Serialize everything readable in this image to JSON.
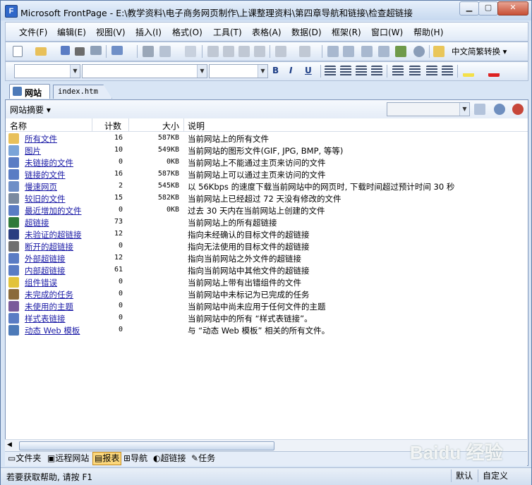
{
  "window": {
    "title": "Microsoft FrontPage - E:\\教学资料\\电子商务网页制作\\上课整理资料\\第四章导航和链接\\检查超链接"
  },
  "menu": [
    "文件(F)",
    "编辑(E)",
    "视图(V)",
    "插入(I)",
    "格式(O)",
    "工具(T)",
    "表格(A)",
    "数据(D)",
    "框架(R)",
    "窗口(W)",
    "帮助(H)"
  ],
  "toolbar": {
    "convert_label": "中文简繁转换 ▾"
  },
  "format_toolbar": {
    "bold": "B",
    "italic": "I",
    "underline": "U"
  },
  "tabs": {
    "site": "网站",
    "file": "index.htm"
  },
  "report": {
    "selector": "网站摘要 ▾"
  },
  "columns": {
    "name": "名称",
    "count": "计数",
    "size": "大小",
    "desc": "说明"
  },
  "rows": [
    {
      "name": "所有文件",
      "count": "16",
      "size": "587KB",
      "desc": "当前网站上的所有文件",
      "icon": "all-files-icon"
    },
    {
      "name": "图片",
      "count": "10",
      "size": "549KB",
      "desc": "当前网站的图形文件(GIF, JPG, BMP, 等等)",
      "icon": "pictures-icon"
    },
    {
      "name": "未链接的文件",
      "count": "0",
      "size": "0KB",
      "desc": "当前网站上不能通过主页来访问的文件",
      "icon": "unlinked-files-icon"
    },
    {
      "name": "链接的文件",
      "count": "16",
      "size": "587KB",
      "desc": "当前网站上可以通过主页来访问的文件",
      "icon": "linked-files-icon"
    },
    {
      "name": "慢速网页",
      "count": "2",
      "size": "545KB",
      "desc": "以 56Kbps 的速度下载当前网站中的网页时, 下载时间超过预计时间 30 秒",
      "icon": "slow-pages-icon"
    },
    {
      "name": "较旧的文件",
      "count": "15",
      "size": "582KB",
      "desc": "当前网站上已经超过 72 天没有修改的文件",
      "icon": "older-files-icon"
    },
    {
      "name": "最近增加的文件",
      "count": "0",
      "size": "0KB",
      "desc": "过去 30 天内在当前网站上创建的文件",
      "icon": "recent-files-icon"
    },
    {
      "name": "超链接",
      "count": "73",
      "size": "",
      "desc": "当前网站上的所有超链接",
      "icon": "hyperlinks-icon"
    },
    {
      "name": "未验证的超链接",
      "count": "12",
      "size": "",
      "desc": "指向未经确认的目标文件的超链接",
      "icon": "unverified-links-icon"
    },
    {
      "name": "断开的超链接",
      "count": "0",
      "size": "",
      "desc": "指向无法使用的目标文件的超链接",
      "icon": "broken-links-icon"
    },
    {
      "name": "外部超链接",
      "count": "12",
      "size": "",
      "desc": "指向当前网站之外文件的超链接",
      "icon": "external-links-icon"
    },
    {
      "name": "内部超链接",
      "count": "61",
      "size": "",
      "desc": "指向当前网站中其他文件的超链接",
      "icon": "internal-links-icon"
    },
    {
      "name": "组件错误",
      "count": "0",
      "size": "",
      "desc": "当前网站上带有出错组件的文件",
      "icon": "component-errors-icon"
    },
    {
      "name": "未完成的任务",
      "count": "0",
      "size": "",
      "desc": "当前网站中未标记为已完成的任务",
      "icon": "tasks-icon"
    },
    {
      "name": "未使用的主题",
      "count": "0",
      "size": "",
      "desc": "当前网站中尚未应用于任何文件的主题",
      "icon": "unused-themes-icon"
    },
    {
      "name": "样式表链接",
      "count": "0",
      "size": "",
      "desc": "当前网站中的所有 “样式表链接”。",
      "icon": "style-sheet-links-icon"
    },
    {
      "name": "动态 Web 模板",
      "count": "0",
      "size": "",
      "desc": "与 “动态 Web 模板” 相关的所有文件。",
      "icon": "dwt-icon"
    }
  ],
  "views": {
    "folders": "文件夹",
    "remote": "远程网站",
    "reports": "报表",
    "navigation": "导航",
    "hyperlinks": "超链接",
    "tasks": "任务"
  },
  "status": {
    "help": "若要获取帮助, 请按 F1",
    "default": "默认",
    "custom": "自定义"
  },
  "watermark": "Baidu 经验"
}
